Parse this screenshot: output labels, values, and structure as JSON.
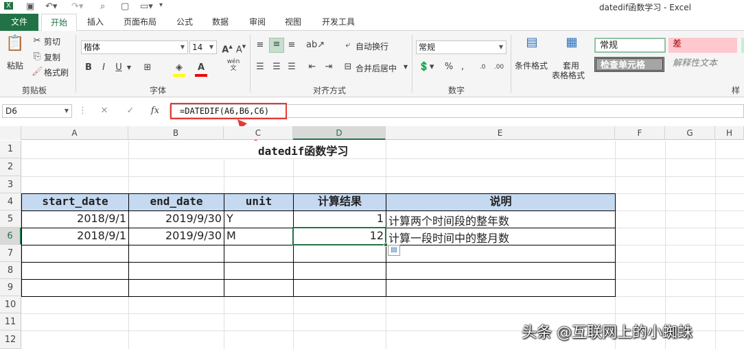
{
  "window": {
    "title": "datedif函数学习 - Excel"
  },
  "tabs": [
    "文件",
    "开始",
    "插入",
    "页面布局",
    "公式",
    "数据",
    "审阅",
    "视图",
    "开发工具"
  ],
  "ribbon": {
    "clipboard": {
      "paste": "粘贴",
      "cut": "剪切",
      "copy": "复制",
      "format_painter": "格式刷",
      "label": "剪贴板"
    },
    "font": {
      "name": "楷体",
      "size": "14",
      "label": "字体",
      "wen": "wén\n文"
    },
    "alignment": {
      "wrap": "自动换行",
      "merge": "合并后居中",
      "label": "对齐方式"
    },
    "number": {
      "format": "常规",
      "label": "数字"
    },
    "styles": {
      "conditional": "条件格式",
      "table_format_1": "套用",
      "table_format_2": "表格格式",
      "normal": "常规",
      "bad": "差",
      "check_cell": "检查单元格",
      "explanatory": "解释性文本",
      "label_partial": "样"
    }
  },
  "formula_bar": {
    "name_box": "D6",
    "formula": "=DATEDIF(A6,B6,C6)",
    "fx": "fx"
  },
  "annotation": {
    "text": "datedif函数学习"
  },
  "columns": [
    "A",
    "B",
    "C",
    "D",
    "E",
    "F",
    "G",
    "H"
  ],
  "rows": [
    "1",
    "2",
    "3",
    "4",
    "5",
    "6",
    "7",
    "8",
    "9",
    "10",
    "11",
    "12"
  ],
  "table": {
    "headers": [
      "start_date",
      "end_date",
      "unit",
      "计算结果",
      "说明"
    ],
    "rows": [
      [
        "2018/9/1",
        "2019/9/30",
        "Y",
        "1",
        "计算两个时间段的整年数"
      ],
      [
        "2018/9/1",
        "2019/9/30",
        "M",
        "12",
        "计算一段时间中的整月数"
      ]
    ]
  },
  "watermark": "头条 @互联网上的小蜘蛛",
  "colors": {
    "excel_green": "#217346",
    "header_fill": "#c5d9f1",
    "highlight_red": "#e53935"
  }
}
